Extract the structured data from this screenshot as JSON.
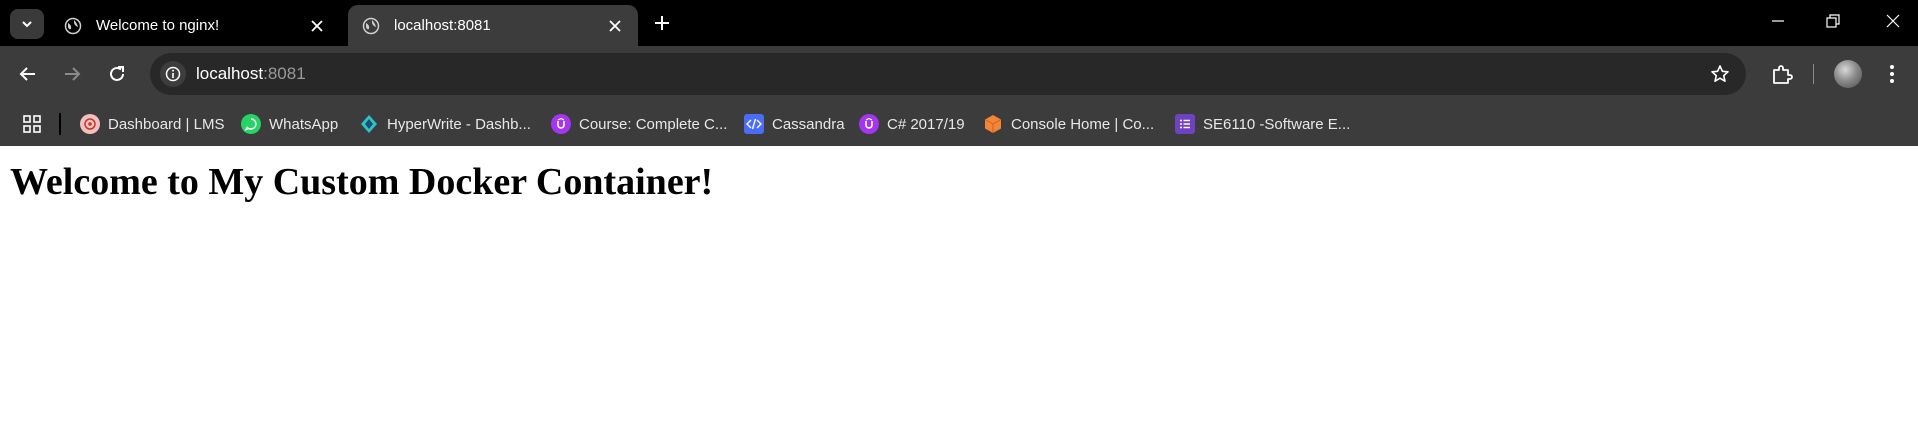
{
  "tabs": [
    {
      "title": "Welcome to nginx!",
      "active": false
    },
    {
      "title": "localhost:8081",
      "active": true
    }
  ],
  "address_bar": {
    "host": "localhost",
    "port": ":8081"
  },
  "bookmarks": [
    {
      "label": "Dashboard | LMS",
      "icon": "lms-icon",
      "color": "#f3c0c0"
    },
    {
      "label": "WhatsApp",
      "icon": "whatsapp-icon",
      "color": "#25d366"
    },
    {
      "label": "HyperWrite - Dashb...",
      "icon": "hyperwrite-icon",
      "color": "#2ec4c4"
    },
    {
      "label": "Course: Complete C...",
      "icon": "udemy-icon",
      "color": "#a435f0"
    },
    {
      "label": "Cassandra",
      "icon": "code-icon",
      "color": "#4a6cf7"
    },
    {
      "label": "C# 2017/19",
      "icon": "udemy-icon",
      "color": "#a435f0"
    },
    {
      "label": "Console Home | Co...",
      "icon": "aws-cube-icon",
      "color": "#f58536"
    },
    {
      "label": "SE6110 -Software E...",
      "icon": "forms-list-icon",
      "color": "#6f42c1"
    }
  ],
  "page": {
    "heading": "Welcome to My Custom Docker Container!"
  },
  "colors": {
    "tabstrip_bg": "#000000",
    "toolbar_bg": "#3c3c3c",
    "omnibox_bg": "#282828",
    "page_bg": "#ffffff"
  }
}
